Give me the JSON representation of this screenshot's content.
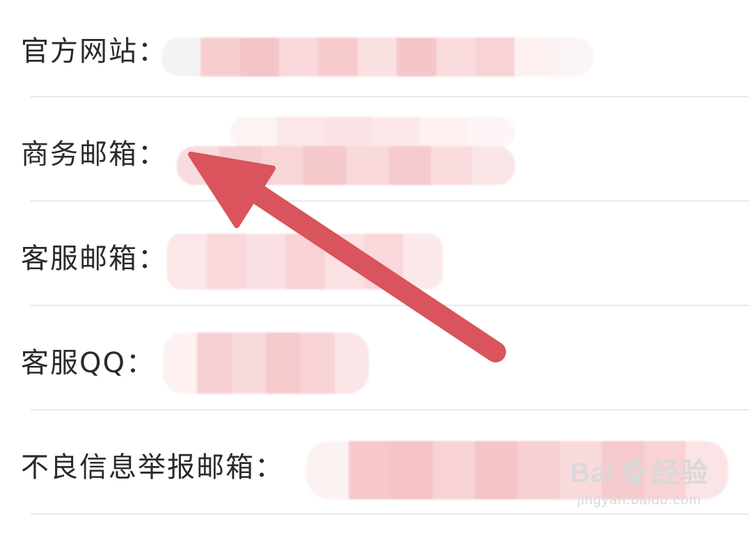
{
  "rows": [
    {
      "label": "官方网站："
    },
    {
      "label": "商务邮箱："
    },
    {
      "label": "客服邮箱："
    },
    {
      "label": "客服QQ："
    },
    {
      "label": "不良信息举报邮箱："
    }
  ],
  "colors": {
    "arrow": "#d9545c",
    "redaction": "#f6cfd2",
    "divider": "#e9e9e9",
    "label_text": "#2a2a2a"
  },
  "watermark": {
    "brand_left": "Bai",
    "brand_right": "经验",
    "url": "jingyan.baidu.com"
  },
  "icons": [
    "arrow-annotation-icon",
    "baidu-paw-icon"
  ]
}
